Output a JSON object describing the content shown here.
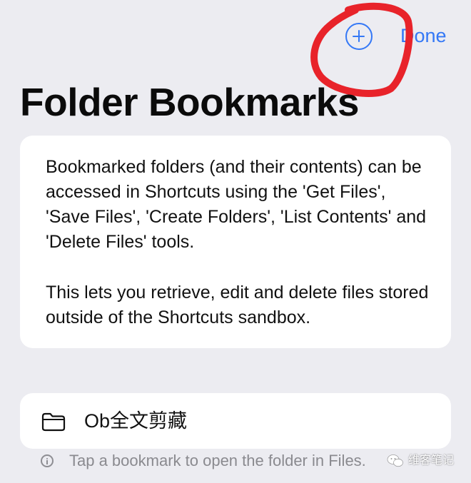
{
  "nav": {
    "add_icon": "plus-circle-icon",
    "done_label": "Done",
    "accent_color": "#3478f6"
  },
  "title": "Folder Bookmarks",
  "info_card": {
    "paragraph_1": "Bookmarked folders (and their contents) can be accessed in Shortcuts using the 'Get Files', 'Save Files', 'Create Folders', 'List Contents' and 'Delete Files' tools.",
    "paragraph_2": "This lets you retrieve, edit and delete files stored outside of the Shortcuts sandbox."
  },
  "bookmarks": [
    {
      "icon": "folder-icon",
      "name": "Ob全文剪藏"
    }
  ],
  "footer": {
    "icon": "info-circle-icon",
    "text": "Tap a bookmark to open the folder in Files."
  },
  "watermark": {
    "text": "维客笔记"
  },
  "annotation": {
    "shape": "hand-drawn circle",
    "color": "#e8232a"
  }
}
